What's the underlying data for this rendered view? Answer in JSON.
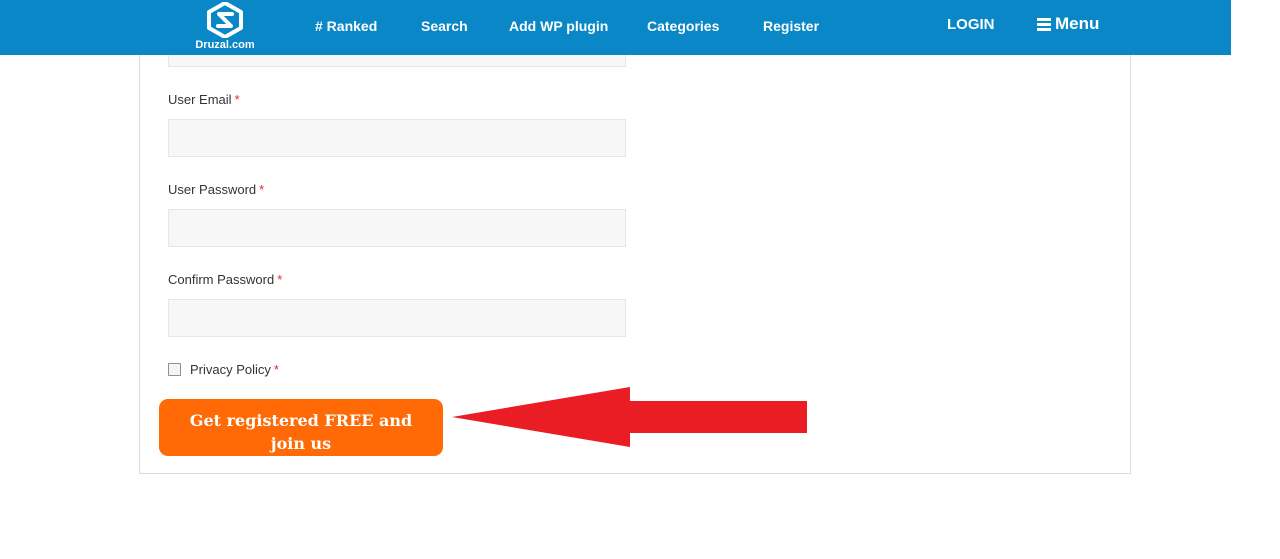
{
  "header": {
    "brand": "Druzal.com",
    "nav": [
      "# Ranked",
      "Search",
      "Add WP plugin",
      "Categories",
      "Register"
    ],
    "login": "LOGIN",
    "menu": "Menu",
    "brand_color": "#0a87c6"
  },
  "form": {
    "email_label": "User Email",
    "password_label": "User Password",
    "confirm_label": "Confirm Password",
    "privacy_label": "Privacy Policy",
    "required_mark": "*",
    "email_value": "",
    "password_value": "",
    "confirm_value": "",
    "privacy_checked": false,
    "submit_label": "Get registered FREE and join us",
    "submit_color": "#ff6a06"
  },
  "annotation": {
    "arrow_color": "#ea1c24"
  }
}
